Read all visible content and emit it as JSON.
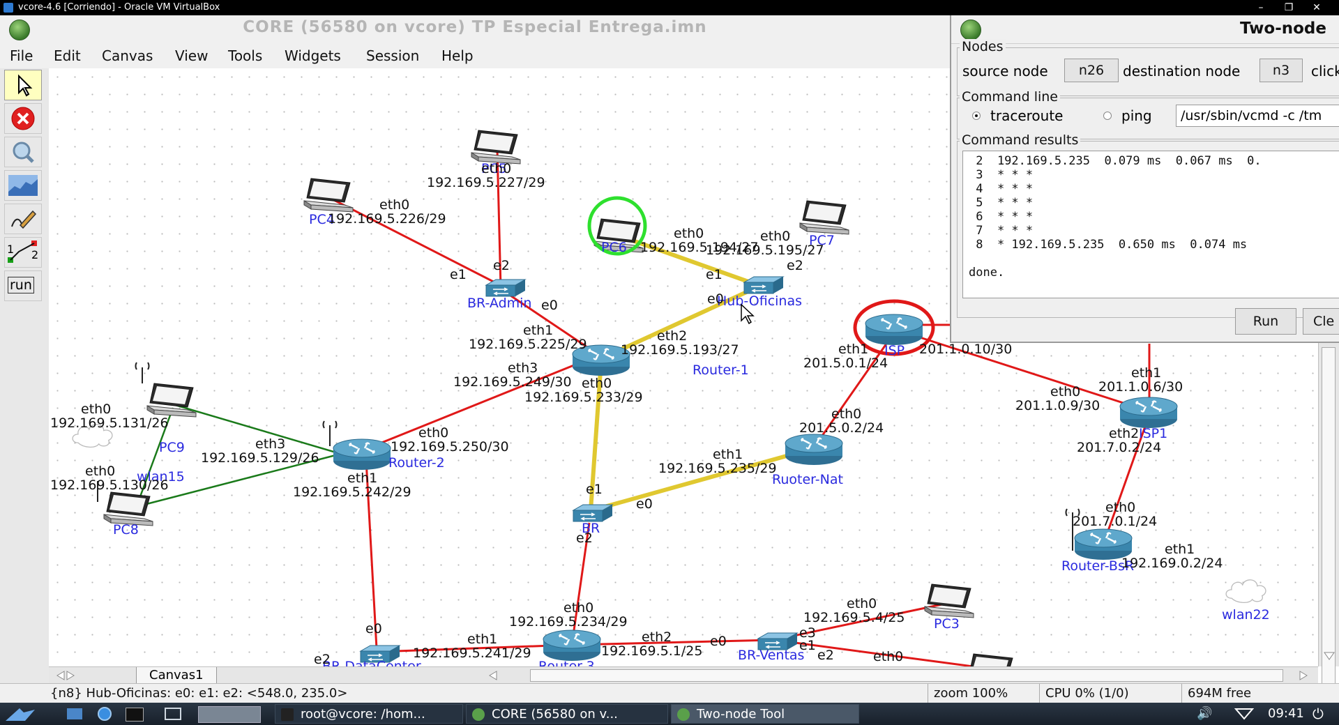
{
  "vbox": {
    "title": "vcore-4.6 [Corriendo] - Oracle VM VirtualBox"
  },
  "core": {
    "title": "CORE (56580 on vcore) TP Especial Entrega.imn",
    "menu": [
      "File",
      "Edit",
      "Canvas",
      "View",
      "Tools",
      "Widgets",
      "Session",
      "Help"
    ],
    "tools": {
      "run_label": "run"
    }
  },
  "canvas": {
    "tab": "Canvas1",
    "node_names": {
      "pc5": "PC5",
      "pc4": "PC4",
      "pc6": "PC6",
      "pc7": "PC7",
      "pc9": "PC9",
      "pc8": "PC8",
      "pc3": "PC3",
      "br_admin": "BR-Admin",
      "hub_oficinas": "Hub-Oficinas",
      "router1": "Router-1",
      "router2": "Router-2",
      "br": "BR",
      "router3": "Router-3",
      "br_datacenter": "BR-DataCenter",
      "br_ventas": "BR-Ventas",
      "isp": "ISP",
      "isp1": "ISP1",
      "ruoter_nat": "Ruoter-Nat",
      "router_bsr": "Router-BsR",
      "wlan15": "wlan15",
      "wlan22": "wlan22"
    },
    "labels": {
      "pc5_eth0": "eth0",
      "pc5_ip": "192.169.5.227/29",
      "pc4_eth0": "eth0",
      "pc4_ip": "192.169.5.226/29",
      "pc6_eth0": "eth0",
      "pc6_ip": "192.169.5.194/27",
      "pc7_eth0": "eth0",
      "pc7_ip": "192.169.5.195/27",
      "bradmin_e2": "e2",
      "bradmin_e1": "e1",
      "bradmin_e0": "e0",
      "hub_e1": "e1",
      "hub_e2": "e2",
      "hub_e0": "e0",
      "r1_eth1": "eth1",
      "r1_eth1_ip": "192.169.5.225/29",
      "r1_eth2": "eth2",
      "r1_eth2_ip": "192.169.5.193/27",
      "r1_eth3": "eth3",
      "r1_eth3_ip": "192.169.5.249/30",
      "r1_eth0": "eth0",
      "r1_eth0_ip": "192.169.5.233/29",
      "pc9_eth0": "eth0",
      "pc9_ip": "192.169.5.131/26",
      "pc8_eth0": "eth0",
      "pc8_ip": "192.169.5.130/26",
      "r2_eth3": "eth3",
      "r2_eth3_ip": "192.169.5.129/26",
      "r2_eth0": "eth0",
      "r2_eth0_ip": "192.169.5.250/30",
      "r2_eth1": "eth1",
      "r2_eth1_ip": "192.169.5.242/29",
      "br_e1": "e1",
      "br_e0": "e0",
      "br_e2": "e2",
      "nat_eth1": "eth1",
      "nat_eth1_ip": "192.169.5.235/29",
      "nat_eth0": "eth0",
      "nat_eth0_ip": "201.5.0.2/24",
      "isp_eth1": "eth1",
      "isp_eth1_ip": "201.5.0.1/24",
      "isp_eth2_ip": "201.1.0.10/30",
      "isp1_eth1": "eth1",
      "isp1_eth1_ip": "201.1.0.6/30",
      "isp1_eth0": "eth0",
      "isp1_eth0_ip": "201.1.0.9/30",
      "isp1_eth2": "eth2",
      "isp1_eth2_ip": "201.7.0.2/24",
      "bsr_eth0": "eth0",
      "bsr_eth0_ip": "201.7.0.1/24",
      "bsr_eth1": "eth1",
      "bsr_eth1_ip": "192.169.0.2/24",
      "r3_eth0": "eth0",
      "r3_eth0_ip": "192.169.5.234/29",
      "r3_eth1": "eth1",
      "r3_eth1_ip": "192.169.5.241/29",
      "r3_eth2": "eth2",
      "r3_eth2_ip": "192.169.5.1/25",
      "dc_e0": "e0",
      "dc_e2": "e2",
      "bv_e0": "e0",
      "bv_e3": "e3",
      "bv_e1": "e1",
      "bv_e2": "e2",
      "pc3_eth0": "eth0",
      "pc3_ip": "192.169.5.4/25",
      "bv_eth0b": "eth0"
    }
  },
  "tool": {
    "title": "Two-node",
    "nodes_label": "Nodes",
    "source_label": "source node",
    "source_value": "n26",
    "dest_label": "destination node",
    "dest_value": "n3",
    "click_label": "click",
    "cmd_label": "Command line",
    "opt_traceroute": "traceroute",
    "opt_ping": "ping",
    "cmd_value": "/usr/sbin/vcmd -c /tm",
    "results_label": "Command results",
    "results_text": " 2  192.169.5.235  0.079 ms  0.067 ms  0.\n 3  * * *\n 4  * * *\n 5  * * *\n 6  * * *\n 7  * * *\n 8  * 192.169.5.235  0.650 ms  0.074 ms\n\ndone.",
    "run_label": "Run",
    "clear_label": "Cle"
  },
  "status": {
    "message": "{n8} Hub-Oficinas: e0: e1: e2: <548.0, 235.0>",
    "zoom": "zoom 100%",
    "cpu": "CPU 0% (1/0)",
    "mem": "694M free"
  },
  "taskbar": {
    "tasks": [
      "root@vcore: /hom...",
      "CORE (56580 on v...",
      "Two-node Tool"
    ],
    "clock": "09:41"
  },
  "colors": {
    "wired": "#e01818",
    "wireless": "#1a7a1a",
    "path": "#e0c830",
    "highlight_green": "#2ee02e",
    "highlight_red": "#e01818"
  }
}
